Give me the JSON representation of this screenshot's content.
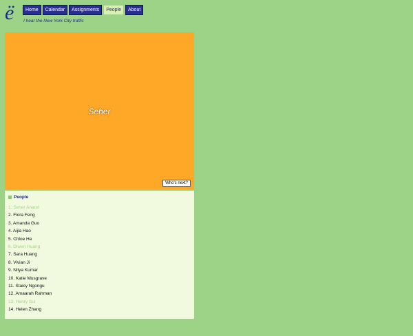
{
  "logo": {
    "glyph": "ë"
  },
  "nav": {
    "items": [
      {
        "label": "Home"
      },
      {
        "label": "Calendar"
      },
      {
        "label": "Assignments"
      },
      {
        "label": "People"
      },
      {
        "label": "About"
      }
    ],
    "active_index": 3
  },
  "tagline": "I hear the New York City traffic",
  "stage": {
    "current_name": "Seher",
    "background": "#ffa726",
    "next_label": "Who's next?"
  },
  "people_panel": {
    "title": "People",
    "items": [
      {
        "label": "1. Seher Anand",
        "done": true
      },
      {
        "label": "2. Flora Feng",
        "done": false
      },
      {
        "label": "3. Amanda Guo",
        "done": false
      },
      {
        "label": "4. Aijia Hao",
        "done": false
      },
      {
        "label": "5. Chloe He",
        "done": false
      },
      {
        "label": "6. Diwen Huang",
        "done": true
      },
      {
        "label": "7. Sara Huang",
        "done": false
      },
      {
        "label": "8. Vivian Ji",
        "done": false
      },
      {
        "label": "9. Nitya Kumar",
        "done": false
      },
      {
        "label": "10. Katie Musgrave",
        "done": false
      },
      {
        "label": "11. Staicy Ngongu",
        "done": false
      },
      {
        "label": "12. Amaarah Rahman",
        "done": false
      },
      {
        "label": "13. Henry Sui",
        "done": true
      },
      {
        "label": "14. Helen Zhang",
        "done": false
      }
    ]
  },
  "colors": {
    "page_bg": "#9dd387",
    "nav_bg": "#2a2f8f",
    "done_text": "#a5d58b"
  }
}
